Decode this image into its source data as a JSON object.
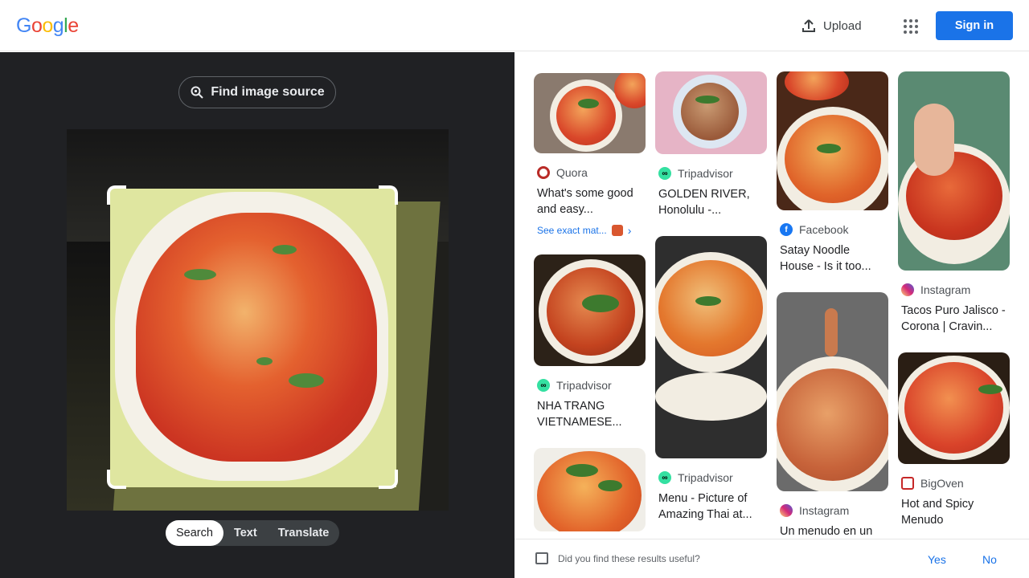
{
  "header": {
    "logo_letters": [
      {
        "char": "G",
        "color": "#4285F4"
      },
      {
        "char": "o",
        "color": "#EA4335"
      },
      {
        "char": "o",
        "color": "#FBBC05"
      },
      {
        "char": "g",
        "color": "#4285F4"
      },
      {
        "char": "l",
        "color": "#34A853"
      },
      {
        "char": "e",
        "color": "#EA4335"
      }
    ],
    "upload_label": "Upload",
    "upload_icon": "upload-icon",
    "apps_icon": "apps-grid-icon",
    "signin_label": "Sign in",
    "accent_color": "#1a73e8"
  },
  "lens": {
    "find_source_label": "Find image source",
    "modes": [
      "Search",
      "Text",
      "Translate"
    ],
    "active_mode": "Search"
  },
  "results": [
    {
      "source": "Quora",
      "source_icon": "quora-icon",
      "icon_color": "#b92b27",
      "title": "What's some good and easy...",
      "exact_match": "See exact mat..."
    },
    {
      "source": "Tripadvisor",
      "source_icon": "tripadvisor-icon",
      "icon_color": "#34e0a1",
      "title": "NHA TRANG VIETNAMESE..."
    },
    {
      "source": "Tripadvisor",
      "source_icon": "tripadvisor-icon",
      "icon_color": "#34e0a1",
      "title": "GOLDEN RIVER, Honolulu -..."
    },
    {
      "source": "Tripadvisor",
      "source_icon": "tripadvisor-icon",
      "icon_color": "#34e0a1",
      "title": "Menu - Picture of Amazing Thai at..."
    },
    {
      "source": "Facebook",
      "source_icon": "facebook-icon",
      "icon_color": "#1877f2",
      "title": "Satay Noodle House - Is it too..."
    },
    {
      "source": "Instagram",
      "source_icon": "instagram-icon",
      "icon_color": "#d62976",
      "title": "Un menudo en un"
    },
    {
      "source": "Instagram",
      "source_icon": "instagram-icon",
      "icon_color": "#d62976",
      "title": "Tacos Puro Jalisco - Corona | Cravin..."
    },
    {
      "source": "BigOven",
      "source_icon": "bigoven-icon",
      "icon_color": "#c62828",
      "title": "Hot and Spicy Menudo"
    }
  ],
  "feedback": {
    "question": "Did you find these results useful?",
    "yes_label": "Yes",
    "no_label": "No"
  }
}
